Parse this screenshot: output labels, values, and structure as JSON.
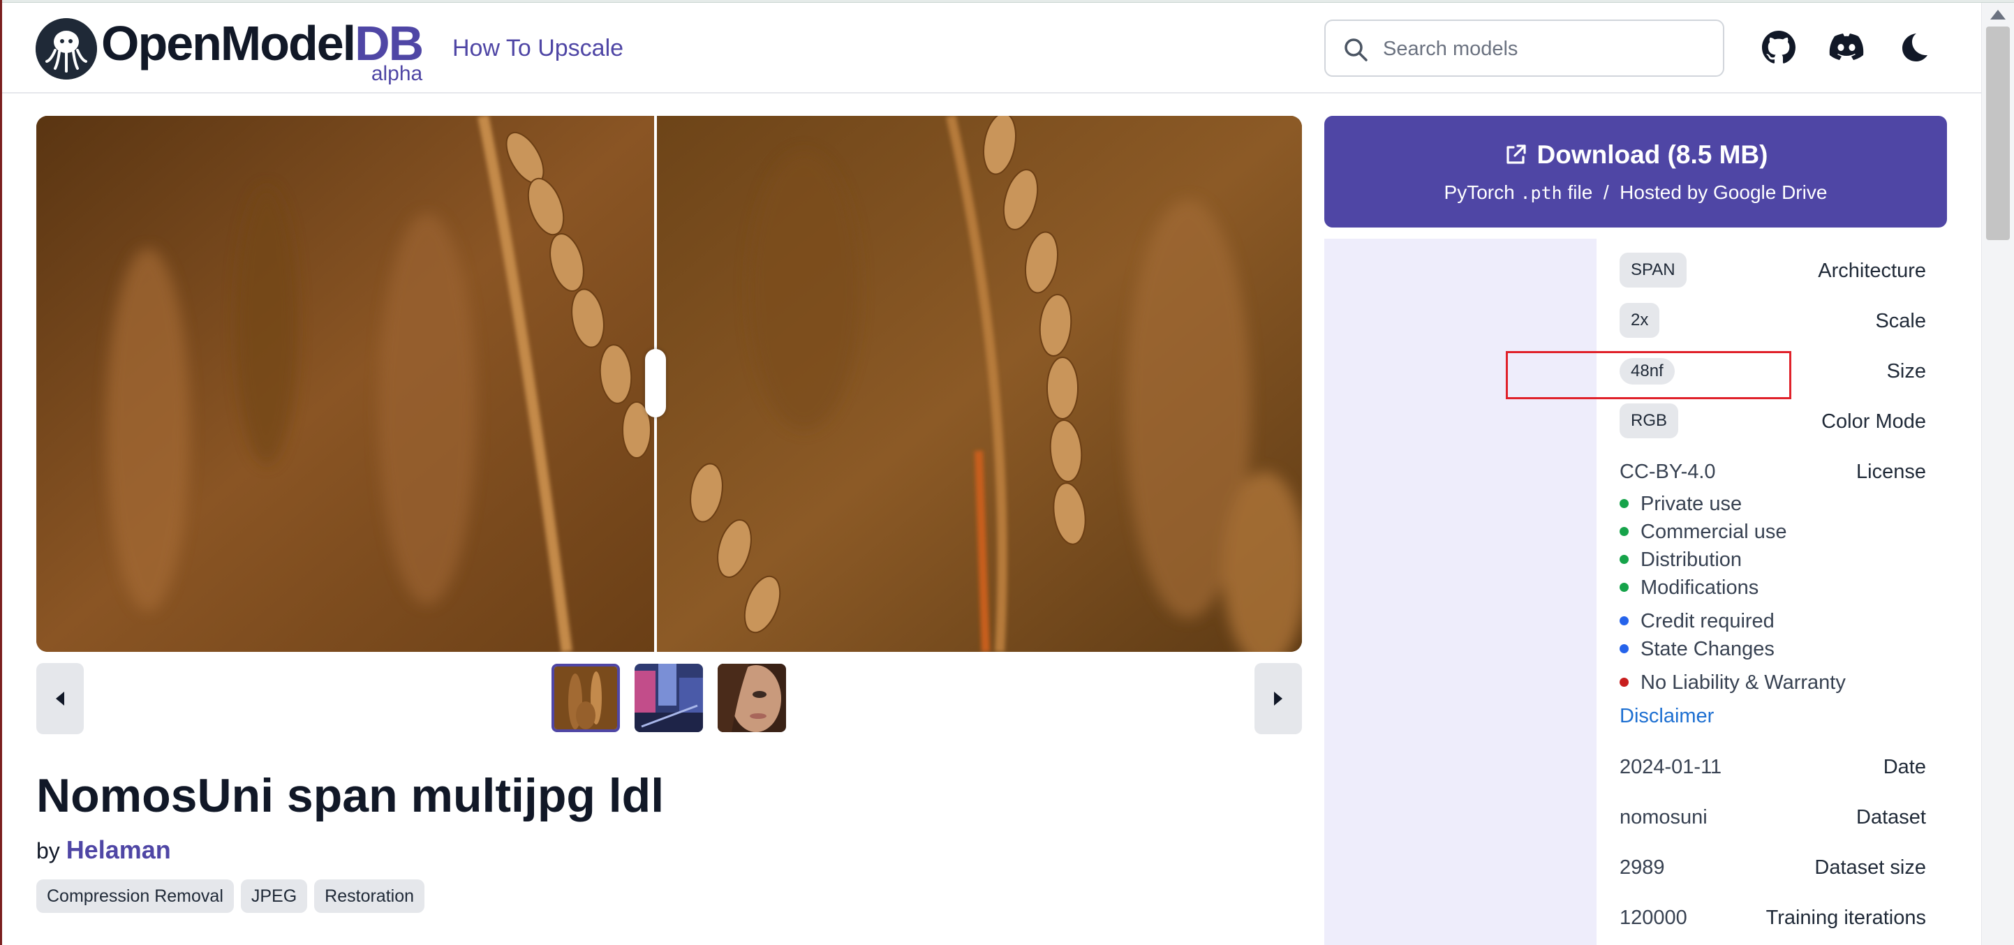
{
  "header": {
    "logo_name": "OpenModel",
    "logo_suffix": "DB",
    "logo_badge": "alpha",
    "nav_link": "How To Upscale",
    "search_placeholder": "Search models",
    "icons": [
      "github-icon",
      "discord-icon",
      "dark-mode-moon-icon"
    ]
  },
  "gallery": {
    "thumbnails": [
      "wheat",
      "city-street",
      "portrait"
    ],
    "active_thumbnail": 0
  },
  "model": {
    "title": "NomosUni span multijpg ldl",
    "by_label": "by",
    "author": "Helaman",
    "tags": [
      "Compression Removal",
      "JPEG",
      "Restoration"
    ]
  },
  "download": {
    "label": "Download (8.5 MB)",
    "sub_prefix": "PyTorch",
    "sub_code": ".pth",
    "sub_suffix": "file  /  Hosted by Google Drive"
  },
  "properties": {
    "architecture_label": "Architecture",
    "architecture": "SPAN",
    "scale_label": "Scale",
    "scale": "2x",
    "size_label": "Size",
    "size": "48nf",
    "color_mode_label": "Color Mode",
    "color_mode": "RGB",
    "license_label": "License",
    "license": "CC-BY-4.0",
    "license_items": [
      {
        "text": "Private use",
        "color": "#16a34a"
      },
      {
        "text": "Commercial use",
        "color": "#16a34a"
      },
      {
        "text": "Distribution",
        "color": "#16a34a"
      },
      {
        "text": "Modifications",
        "color": "#16a34a"
      },
      {
        "text": "Credit required",
        "color": "#2563eb"
      },
      {
        "text": "State Changes",
        "color": "#2563eb"
      },
      {
        "text": "No Liability & Warranty",
        "color": "#c81e1e"
      }
    ],
    "disclaimer": "Disclaimer",
    "date_label": "Date",
    "date": "2024-01-11",
    "dataset_label": "Dataset",
    "dataset": "nomosuni",
    "dataset_size_label": "Dataset size",
    "dataset_size": "2989",
    "training_iterations_label": "Training iterations",
    "training_iterations": "120000"
  },
  "colors": {
    "accent": "#4f46a5",
    "highlight_box": "#e0212a"
  }
}
